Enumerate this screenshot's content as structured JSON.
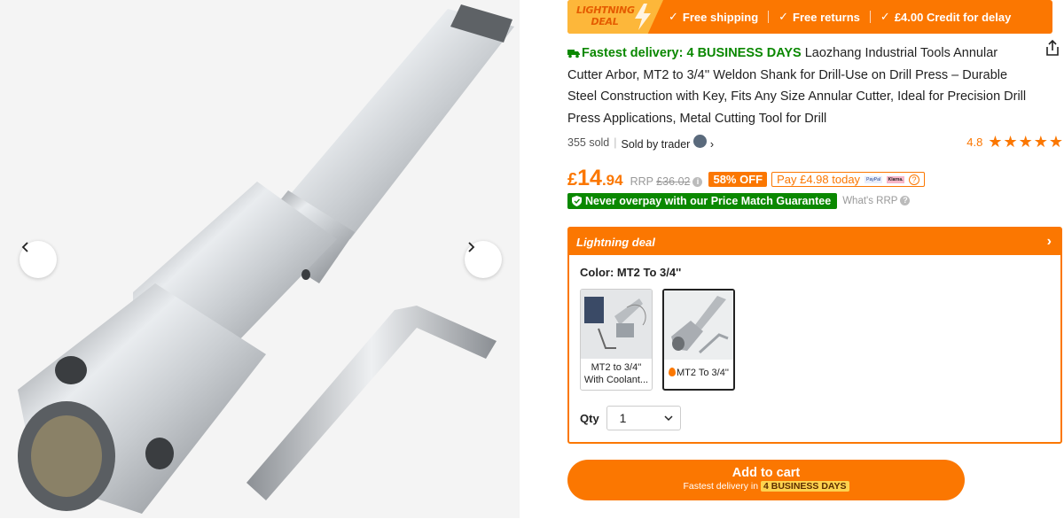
{
  "gallery": {
    "prev_icon": "chevron-left-icon",
    "next_icon": "chevron-right-icon"
  },
  "banner": {
    "tag_line1": "LIGHTNING",
    "tag_line2": "DEAL",
    "items": [
      "Free shipping",
      "Free returns",
      "£4.00 Credit for delay"
    ],
    "accent_color": "#fb7701",
    "tag_color": "#fdb73a"
  },
  "product": {
    "fast_delivery": "Fastest delivery: 4 BUSINESS DAYS",
    "title": "Laozhang Industrial Tools Annular Cutter Arbor, MT2 to 3/4'' Weldon Shank for Drill-Use on Drill Press – Durable Steel Construction with Key, Fits Any Size Annular Cutter, Ideal for Precision Drill Press Applications, Metal Cutting Tool for Drill",
    "sold": "355 sold",
    "seller": "Sold by trader",
    "rating": "4.8",
    "stars": 5
  },
  "price": {
    "currency": "£",
    "whole": "14",
    "decimal": ".94",
    "rrp_label": "RRP",
    "rrp_value": "£36.02",
    "off": "58% OFF",
    "pay_today": "Pay £4.98 today",
    "paypal_logo": "PayPal",
    "klarna_logo": "Klarna."
  },
  "guarantee": {
    "text": "Never overpay with our Price Match Guarantee",
    "whats_rrp": "What's RRP",
    "color": "#0a8800"
  },
  "deal": {
    "header": "Lightning deal",
    "color_label": "Color: MT2 To 3/4''",
    "variants": [
      {
        "label": "MT2 to 3/4'' With Coolant..."
      },
      {
        "label": "MT2 To 3/4''"
      }
    ],
    "qty_label": "Qty",
    "qty_value": "1"
  },
  "cart": {
    "label": "Add to cart",
    "sub_prefix": "Fastest delivery in",
    "sub_days": "4 BUSINESS DAYS"
  }
}
